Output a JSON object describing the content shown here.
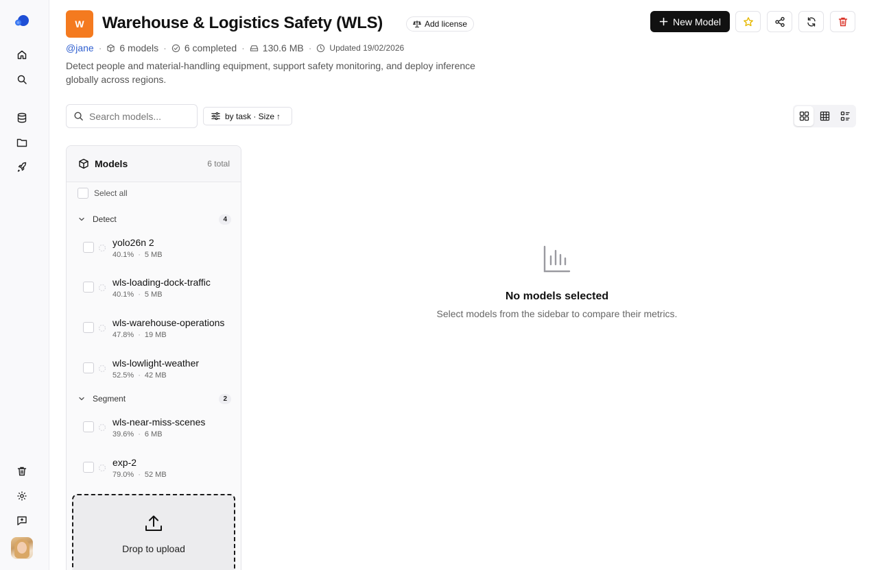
{
  "project": {
    "badge_letter": "W",
    "badge_color": "#f47a1f",
    "title": "Warehouse & Logistics Safety (WLS)",
    "license_label": "Add license",
    "owner": "@jane",
    "models_count": "6 models",
    "completed": "6 completed",
    "size": "130.6 MB",
    "updated": "Updated 19/02/2026",
    "description": "Detect people and material-handling equipment, support safety monitoring, and deploy inference globally across regions."
  },
  "actions": {
    "new_model": "New Model"
  },
  "toolbar": {
    "search_placeholder": "Search models...",
    "sort_label": "by task · Size"
  },
  "sidebar": {
    "title": "Models",
    "total": "6 total",
    "select_all": "Select all",
    "groups": [
      {
        "name": "Detect",
        "count": "4",
        "models": [
          {
            "name": "yolo26n 2",
            "metric": "40.1%",
            "size": "5 MB"
          },
          {
            "name": "wls-loading-dock-traffic",
            "metric": "40.1%",
            "size": "5 MB"
          },
          {
            "name": "wls-warehouse-operations",
            "metric": "47.8%",
            "size": "19 MB"
          },
          {
            "name": "wls-lowlight-weather",
            "metric": "52.5%",
            "size": "42 MB"
          }
        ]
      },
      {
        "name": "Segment",
        "count": "2",
        "models": [
          {
            "name": "wls-near-miss-scenes",
            "metric": "39.6%",
            "size": "6 MB"
          },
          {
            "name": "exp-2",
            "metric": "79.0%",
            "size": "52 MB"
          }
        ]
      }
    ],
    "upload_label": "Drop to upload"
  },
  "empty_state": {
    "title": "No models selected",
    "subtitle": "Select models from the sidebar to compare their metrics."
  },
  "icons": {
    "accent_star": "#e6b800",
    "danger": "#d93025"
  }
}
